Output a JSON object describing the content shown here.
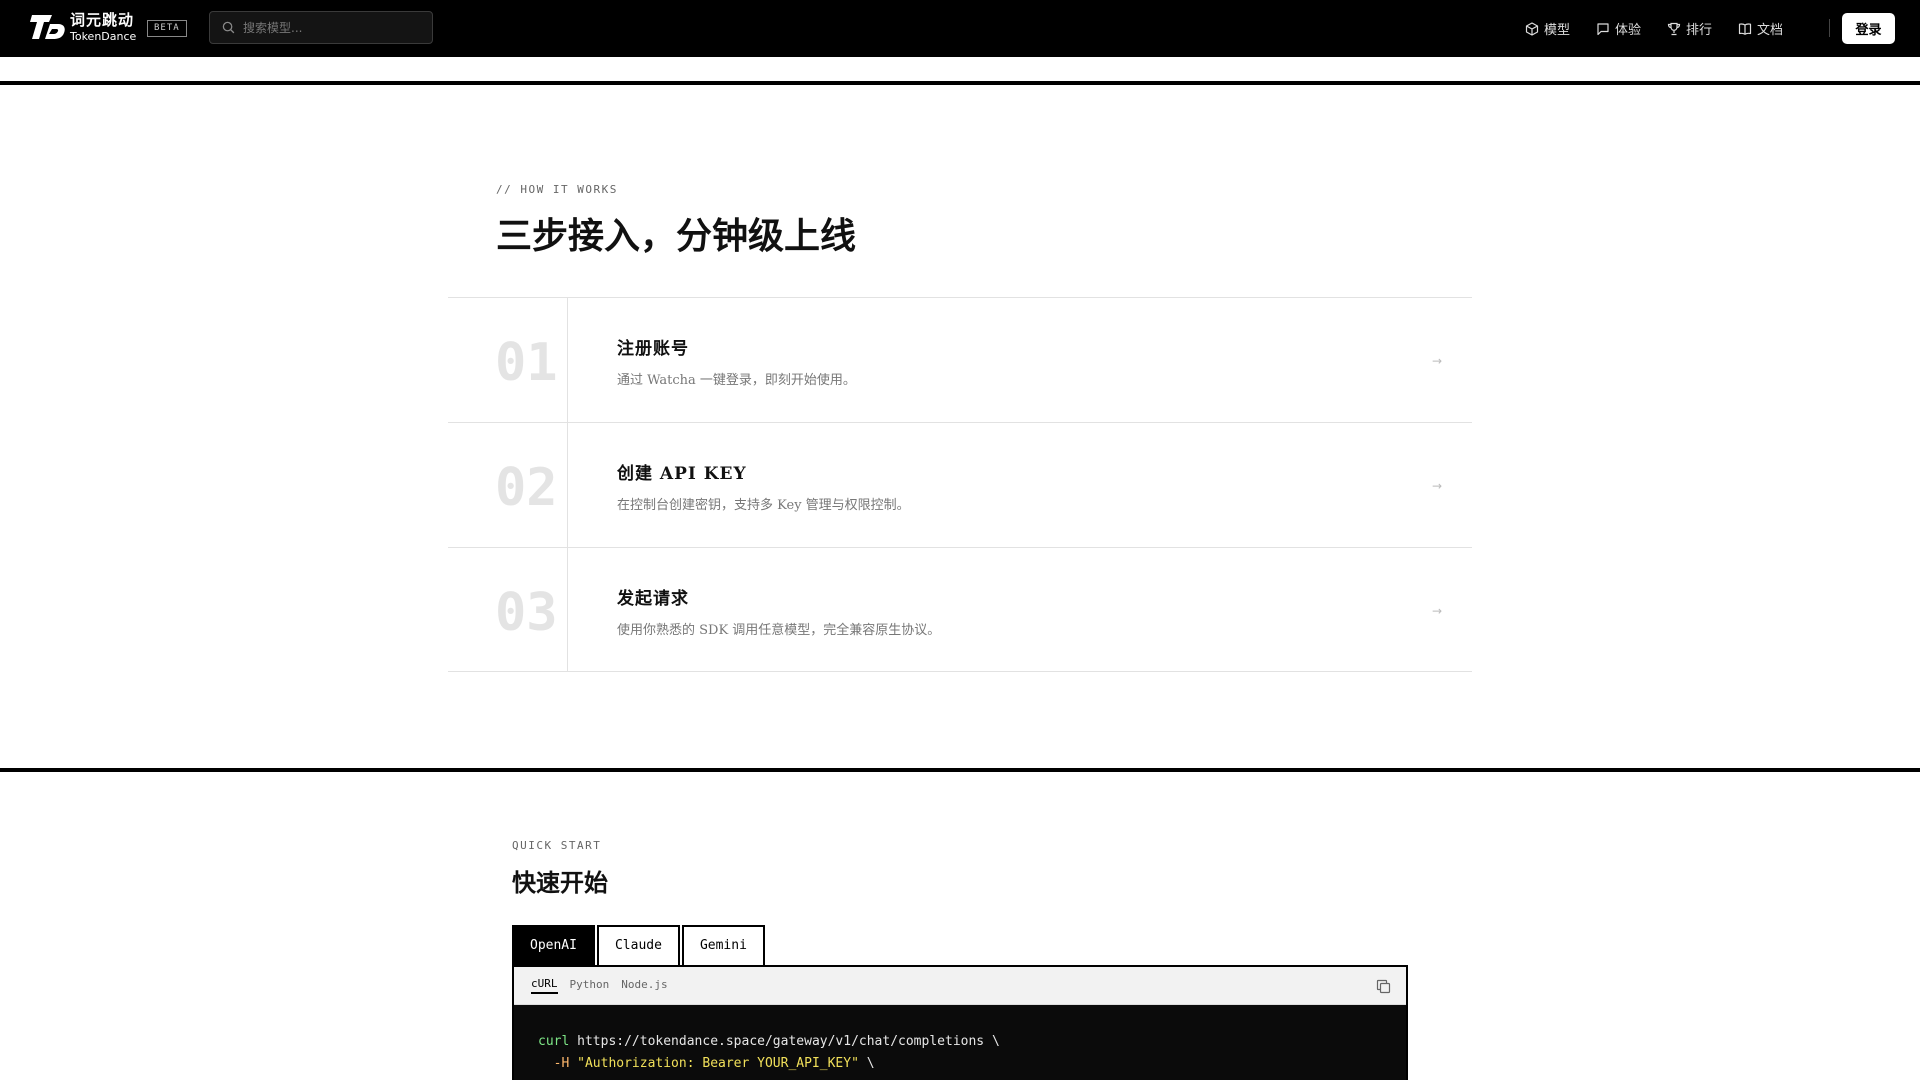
{
  "brand": {
    "name_cn": "词元跳动",
    "name_en": "TokenDance",
    "badge": "BETA"
  },
  "search": {
    "placeholder": "搜索模型..."
  },
  "nav": {
    "items": [
      {
        "label": "模型",
        "icon": "cube-icon"
      },
      {
        "label": "体验",
        "icon": "chat-bubble-icon"
      },
      {
        "label": "排行",
        "icon": "trophy-icon"
      },
      {
        "label": "文档",
        "icon": "book-icon"
      }
    ],
    "login_label": "登录"
  },
  "how_it_works": {
    "eyebrow": "// HOW IT WORKS",
    "title": "三步接入，分钟级上线",
    "steps": [
      {
        "num": "01",
        "title": "注册账号",
        "desc": "通过 Watcha 一键登录，即刻开始使用。",
        "arrow": "→"
      },
      {
        "num": "02",
        "title": "创建 API KEY",
        "desc": "在控制台创建密钥，支持多 Key 管理与权限控制。",
        "arrow": "→"
      },
      {
        "num": "03",
        "title": "发起请求",
        "desc": "使用你熟悉的 SDK 调用任意模型，完全兼容原生协议。",
        "arrow": "→"
      }
    ]
  },
  "quick_start": {
    "eyebrow": "QUICK START",
    "title": "快速开始",
    "provider_tabs": [
      "OpenAI",
      "Claude",
      "Gemini"
    ],
    "active_provider": "OpenAI",
    "lang_tabs": [
      "cURL",
      "Python",
      "Node.js"
    ],
    "active_lang": "cURL",
    "code": {
      "line1_cmd": "curl",
      "line1_url": " https://tokendance.space/gateway/v1/chat/completions \\",
      "line2_flag": "  -H ",
      "line2_str": "\"Authorization: Bearer YOUR_API_KEY\"",
      "line2_tail": " \\"
    }
  },
  "colors": {
    "header_bg": "#000000",
    "accent": "#000000",
    "muted": "#777777"
  }
}
